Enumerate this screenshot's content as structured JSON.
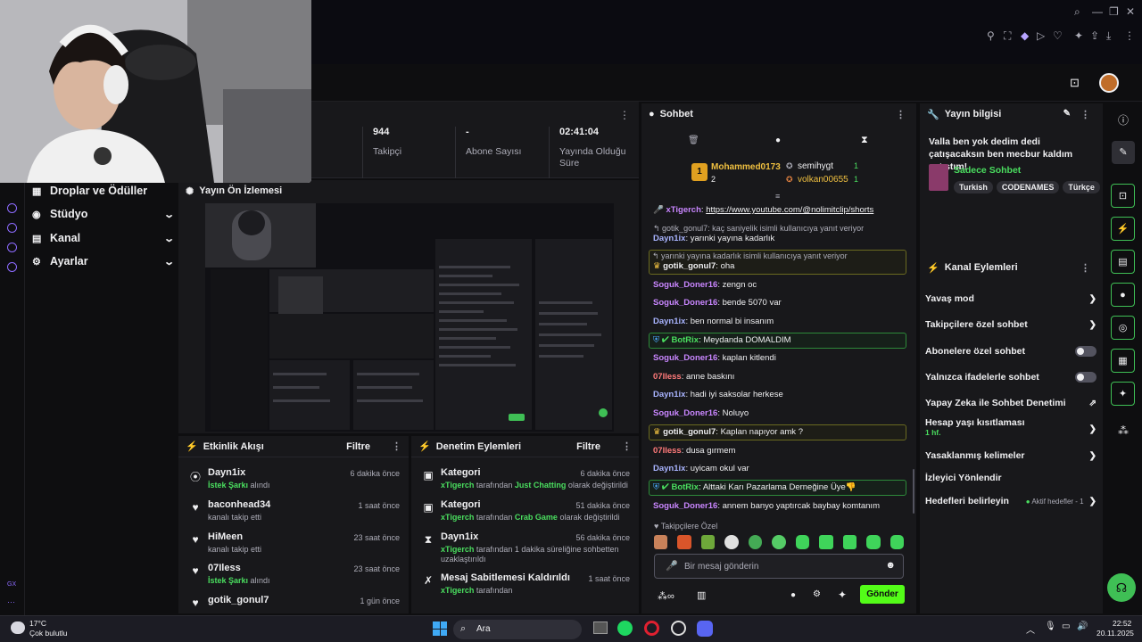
{
  "colors": {
    "accent": "#9147ff",
    "green": "#4ade5f",
    "bg": "#0e0e10",
    "panel": "#18181b"
  },
  "stats": [
    {
      "value": "944",
      "label": "Takipçi"
    },
    {
      "value": "-",
      "label": "Abone Sayısı"
    },
    {
      "value": "02:41:04",
      "label": "Yayında Olduğu Süre"
    }
  ],
  "nav": {
    "items": [
      {
        "label": "Droplar ve Ödüller",
        "icon": "gift-icon"
      },
      {
        "label": "Stüdyo",
        "icon": "studio-icon"
      },
      {
        "label": "Kanal",
        "icon": "channel-icon"
      },
      {
        "label": "Ayarlar",
        "icon": "gear-icon"
      }
    ],
    "gx_label": "GX"
  },
  "preview": {
    "title": "Yayın Ön İzlemesi"
  },
  "activity": {
    "title": "Etkinlik Akışı",
    "filter": "Filtre",
    "items": [
      {
        "name": "Dayn1ix",
        "highlight": "İstek Şarkı",
        "rest": " alındı",
        "time": "6 dakika önce"
      },
      {
        "name": "baconhead34",
        "highlight": "",
        "rest": "kanalı takip etti",
        "time": "1 saat önce"
      },
      {
        "name": "HiMeen",
        "highlight": "",
        "rest": "kanalı takip etti",
        "time": "23 saat önce"
      },
      {
        "name": "07Iless",
        "highlight": "İstek Şarkı",
        "rest": " alındı",
        "time": "23 saat önce"
      },
      {
        "name": "gotik_gonul7",
        "highlight": "",
        "rest": "",
        "time": "1 gün önce"
      }
    ]
  },
  "moderation": {
    "title": "Denetim Eylemleri",
    "filter": "Filtre",
    "items": [
      {
        "title": "Kategori",
        "time": "6 dakika önce",
        "by": "xTigerch",
        "mid": " tarafından ",
        "hl": "Just Chatting",
        "end": " olarak değiştirildi"
      },
      {
        "title": "Kategori",
        "time": "51 dakika önce",
        "by": "xTigerch",
        "mid": " tarafından ",
        "hl": "Crab Game",
        "end": " olarak değiştirildi"
      },
      {
        "title": "Dayn1ix",
        "time": "56 dakika önce",
        "by": "xTigerch",
        "mid": " tarafından 1 dakika süreliğine sohbetten uzaklaştırıldı",
        "hl": "",
        "end": ""
      },
      {
        "title": "Mesaj Sabitlemesi Kaldırıldı",
        "time": "1 saat önce",
        "by": "xTigerch",
        "mid": " tarafından",
        "hl": "",
        "end": ""
      }
    ]
  },
  "chat": {
    "title": "Sohbet",
    "leaders": [
      {
        "rank": "1",
        "name": "Mohammed0173",
        "count": "2"
      },
      {
        "rank": "",
        "name": "semihygt",
        "count": "1"
      },
      {
        "rank": "",
        "name": "volkan00655",
        "count": "1"
      }
    ],
    "followers_only": "Takipçilere Özel",
    "input_placeholder": "Bir mesaj gönderin",
    "send": "Gönder"
  },
  "messages": [
    {
      "user": "xTigerch",
      "cls": "u-p",
      "text": "https://www.youtube.com/@nolimitclip/shorts",
      "reply": ""
    },
    {
      "user": "Dayn1ix",
      "cls": "u-b",
      "text": "yarınki yayına kadarlık",
      "reply": "gotik_gonul7: kaç saniyelik isimli kullanıcıya yanıt veriyor"
    },
    {
      "user": "gotik_gonul7",
      "cls": "u-y",
      "text": "oha",
      "reply": "yarınki yayına kadarlık isimli kullanıcıya yanıt veriyor"
    },
    {
      "user": "Soguk_Doner16",
      "cls": "u-p",
      "text": "zengn oc",
      "reply": ""
    },
    {
      "user": "Soguk_Doner16",
      "cls": "u-p",
      "text": "bende 5070 var",
      "reply": ""
    },
    {
      "user": "Dayn1ix",
      "cls": "u-b",
      "text": "ben normal bi insanım",
      "reply": ""
    },
    {
      "user": "BotRix",
      "cls": "u-g",
      "text": "Meydanda DOMALDIM",
      "reply": ""
    },
    {
      "user": "Soguk_Doner16",
      "cls": "u-p",
      "text": "kaplan kitlendi",
      "reply": ""
    },
    {
      "user": "07Iless",
      "cls": "u-r",
      "text": "anne baskını",
      "reply": ""
    },
    {
      "user": "Dayn1ix",
      "cls": "u-b",
      "text": "hadi iyi saksolar herkese",
      "reply": ""
    },
    {
      "user": "Soguk_Doner16",
      "cls": "u-p",
      "text": "Noluyo",
      "reply": ""
    },
    {
      "user": "gotik_gonul7",
      "cls": "u-y",
      "text": "Kaplan napıyor amk ?",
      "reply": ""
    },
    {
      "user": "07Iless",
      "cls": "u-r",
      "text": "dusa gırmem",
      "reply": ""
    },
    {
      "user": "Dayn1ix",
      "cls": "u-b",
      "text": "uyicam okul var",
      "reply": ""
    },
    {
      "user": "BotRix",
      "cls": "u-g",
      "text": "Alttaki Karı Pazarlama Derneğine Üye👎",
      "reply": ""
    },
    {
      "user": "Soguk_Doner16",
      "cls": "u-p",
      "text": "annem banyo yaptırcak baybay komtanım",
      "reply": ""
    }
  ],
  "info": {
    "title": "Yayın bilgisi",
    "stream_title": "Valla ben yok dedim dedi çatışacaksın ben mecbur kaldım çatıştım!",
    "category": "Sadece Sohbet",
    "tags": [
      "Turkish",
      "CODENAMES",
      "Türkçe"
    ]
  },
  "actions": {
    "title": "Kanal Eylemleri",
    "items": [
      {
        "label": "Yavaş mod",
        "kind": "chevron",
        "sub": ""
      },
      {
        "label": "Takipçilere özel sohbet",
        "kind": "chevron",
        "sub": ""
      },
      {
        "label": "Abonelere özel sohbet",
        "kind": "toggle",
        "sub": ""
      },
      {
        "label": "Yalnızca ifadelerle sohbet",
        "kind": "toggle",
        "sub": ""
      },
      {
        "label": "Yapay Zeka ile Sohbet Denetimi",
        "kind": "external",
        "sub": ""
      },
      {
        "label": "Hesap yaşı kısıtlaması",
        "kind": "chevron",
        "sub": "1 hf."
      },
      {
        "label": "Yasaklanmış kelimeler",
        "kind": "chevron",
        "sub": ""
      },
      {
        "label": "İzleyici Yönlendir",
        "kind": "none",
        "sub": ""
      },
      {
        "label": "Hedefleri belirleyin",
        "kind": "goal",
        "sub": "Aktif hedefler - 1"
      }
    ]
  },
  "taskbar": {
    "weather_temp": "17°C",
    "weather_desc": "Çok bulutlu",
    "search": "Ara",
    "time": "22:52",
    "date": "20.11.2025"
  }
}
